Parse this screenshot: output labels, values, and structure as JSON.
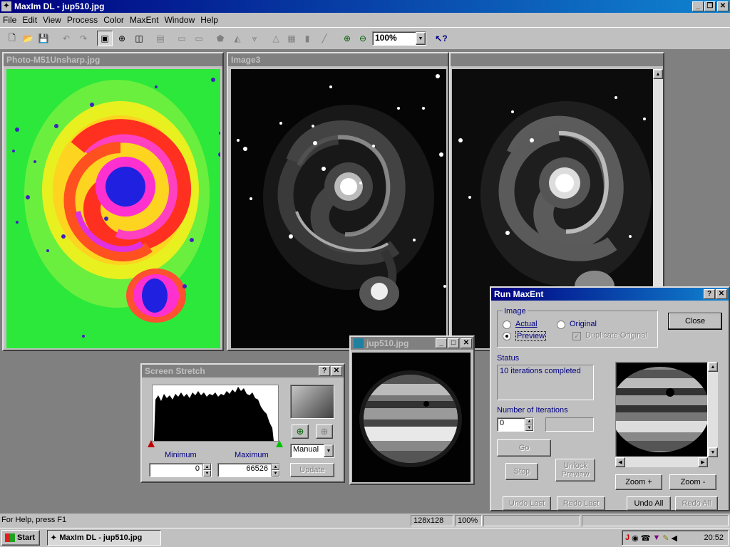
{
  "app": {
    "title": "MaxIm DL - jup510.jpg",
    "menu": [
      "File",
      "Edit",
      "View",
      "Process",
      "Color",
      "MaxEnt",
      "Window",
      "Help"
    ]
  },
  "toolbar": {
    "zoom": "100%"
  },
  "windows": {
    "photo": {
      "title": "Photo-M51Unsharp.jpg"
    },
    "image3": {
      "title": "Image3"
    },
    "jup": {
      "title": "jup510.jpg"
    }
  },
  "stretch": {
    "title": "Screen Stretch",
    "min_label": "Minimum",
    "max_label": "Maximum",
    "min_value": "0",
    "max_value": "66526",
    "mode": "Manual",
    "update": "Update"
  },
  "maxent": {
    "title": "Run MaxEnt",
    "group": "Image",
    "actual": "Actual",
    "original": "Original",
    "preview": "Preview",
    "duplicate": "Duplicate Original",
    "close": "Close",
    "status_label": "Status",
    "status_text": "10 iterations completed",
    "iter_label": "Number of Iterations",
    "iter_value": "0",
    "go": "Go",
    "stop": "Stop",
    "unlock": "Unlock Preview",
    "zoom_in": "Zoom +",
    "zoom_out": "Zoom -",
    "undo_last": "Undo Last",
    "redo_last": "Redo Last",
    "undo_all": "Undo All",
    "redo_all": "Redo All"
  },
  "status": {
    "help": "For Help, press F1",
    "size": "128x128",
    "zoom": "100%"
  },
  "taskbar": {
    "start": "Start",
    "task": "MaxIm DL - jup510.jpg",
    "clock": "20:52"
  }
}
